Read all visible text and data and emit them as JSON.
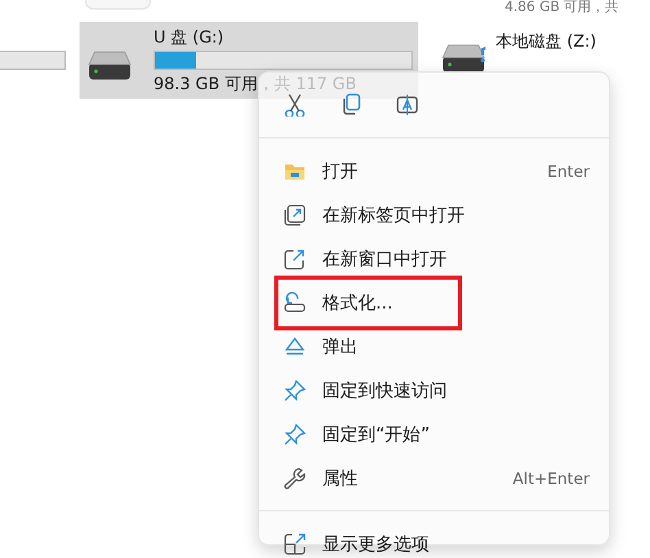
{
  "explorer": {
    "top_text": "4.86 GB 可用，共",
    "drives": [
      {
        "name": "U 盘 (G:)",
        "selected": true,
        "level": 0.16,
        "free_text": "98.3 GB 可用，共 117 GB"
      },
      {
        "name": "本地磁盘 (Z:)",
        "selected": false
      }
    ]
  },
  "context_menu": {
    "items": [
      {
        "label": "打开",
        "shortcut": "Enter",
        "marked": false
      },
      {
        "label": "在新标签页中打开",
        "marked": false
      },
      {
        "label": "在新窗口中打开",
        "marked": false
      },
      {
        "label": "格式化...",
        "marked": true
      },
      {
        "label": "弹出",
        "marked": false
      },
      {
        "label": "固定到快速访问",
        "marked": false
      },
      {
        "label": "固定到“开始”",
        "marked": false
      },
      {
        "label": "属性",
        "shortcut": "Alt+Enter",
        "marked": false
      }
    ],
    "footer": {
      "label": "显示更多选项"
    }
  }
}
